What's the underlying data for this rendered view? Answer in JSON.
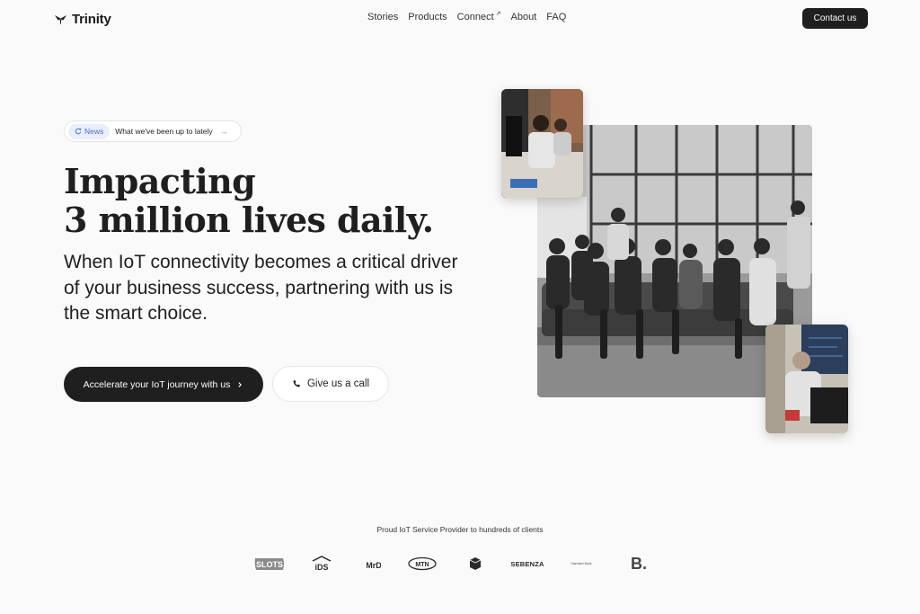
{
  "nav": {
    "brand": "Trinity",
    "items": [
      "Stories",
      "Products",
      "Connect",
      "About",
      "FAQ"
    ],
    "external_marker": "↗",
    "contact_label": "Contact us"
  },
  "news": {
    "tag": "News",
    "text": "What we've been up to lately",
    "arrow": "→"
  },
  "hero": {
    "title_line1": "Impacting",
    "title_line2": "3 million lives daily.",
    "subtitle": "When IoT connectivity becomes a critical driver of your business success, partnering with us is the smart choice.",
    "primary_cta": "Accelerate your IoT journey with us",
    "secondary_cta": "Give us a call"
  },
  "clients": {
    "title": "Proud IoT Service Provider to hundreds of clients",
    "logos": [
      {
        "name": "slots-logo",
        "text": "SLOTS"
      },
      {
        "name": "ids-logo",
        "text": "iDS"
      },
      {
        "name": "mrd-logo",
        "text": "MrD"
      },
      {
        "name": "mtn-logo",
        "text": "MTN"
      },
      {
        "name": "box-logo",
        "text": ""
      },
      {
        "name": "sebenza-logo",
        "text": "SEBENZA"
      },
      {
        "name": "standard-bank-logo",
        "text": "Standard Bank"
      },
      {
        "name": "b-logo",
        "text": "B."
      }
    ]
  },
  "colors": {
    "background": "#fafafa",
    "dark": "#1f1f1f",
    "news_accent": "#4a6bd6",
    "news_tag_bg": "#e8eefc"
  },
  "icons": [
    "trinity-logo-icon",
    "external-link-icon",
    "refresh-icon",
    "arrow-right-icon",
    "chevron-right-icon",
    "phone-icon"
  ]
}
